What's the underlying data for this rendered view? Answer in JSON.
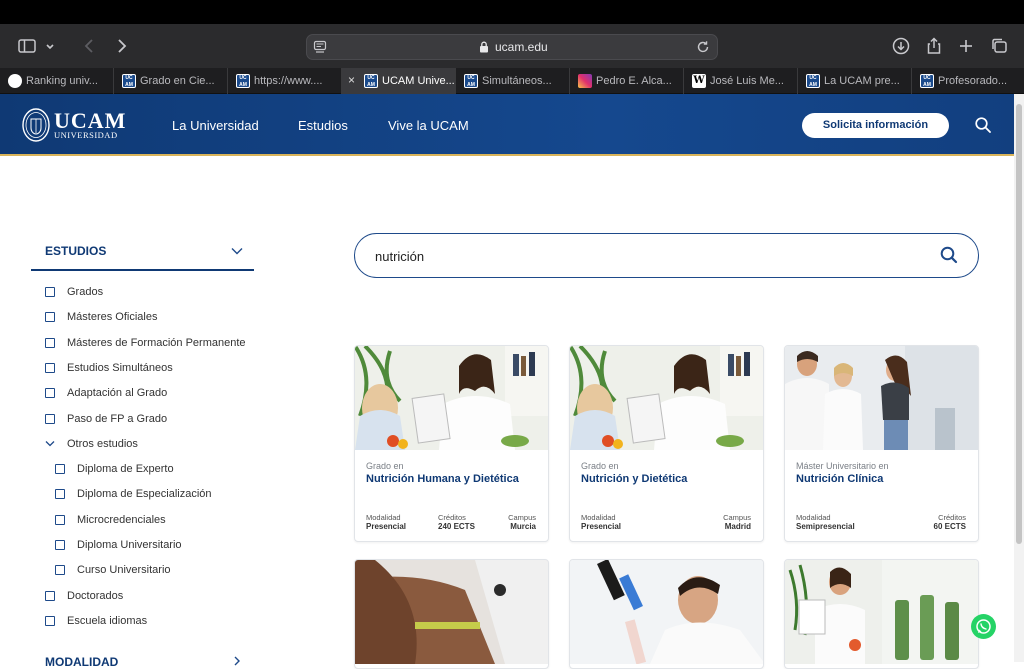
{
  "browser": {
    "url": "ucam.edu",
    "tabs": [
      {
        "label": "Ranking univ...",
        "icon": "ranking-favicon"
      },
      {
        "label": "Grado en Cie...",
        "icon": "ucam-favicon"
      },
      {
        "label": "https://www....",
        "icon": "ucam-favicon"
      },
      {
        "label": "UCAM Unive...",
        "icon": "ucam-favicon",
        "active": true
      },
      {
        "label": "Simultáneos...",
        "icon": "ucam-favicon"
      },
      {
        "label": "Pedro E. Alca...",
        "icon": "instagram-favicon"
      },
      {
        "label": "José Luis Me...",
        "icon": "wikipedia-favicon"
      },
      {
        "label": "La UCAM pre...",
        "icon": "ucam-favicon"
      },
      {
        "label": "Profesorado...",
        "icon": "ucam-favicon"
      }
    ]
  },
  "header": {
    "logo_name": "UCAM",
    "logo_sub": "UNIVERSIDAD",
    "nav": [
      "La Universidad",
      "Estudios",
      "Vive la UCAM"
    ],
    "cta": "Solicita información",
    "brand_color": "#0f3974",
    "accent_color": "#d9b45a"
  },
  "sidebar": {
    "title": "ESTUDIOS",
    "items": [
      {
        "label": "Grados"
      },
      {
        "label": "Másteres Oficiales"
      },
      {
        "label": "Másteres de Formación Permanente"
      },
      {
        "label": "Estudios Simultáneos"
      },
      {
        "label": "Adaptación al Grado"
      },
      {
        "label": "Paso de FP a Grado"
      },
      {
        "label": "Otros estudios",
        "expanded": true
      },
      {
        "label": "Diploma de Experto",
        "sub": true
      },
      {
        "label": "Diploma de Especialización",
        "sub": true
      },
      {
        "label": "Microcredenciales",
        "sub": true
      },
      {
        "label": "Diploma Universitario",
        "sub": true
      },
      {
        "label": "Curso Universitario",
        "sub": true
      },
      {
        "label": "Doctorados"
      },
      {
        "label": "Escuela idiomas"
      }
    ],
    "next_section": "MODALIDAD"
  },
  "search": {
    "value": "nutrición"
  },
  "cards": [
    {
      "kind": "Grado en",
      "title": "Nutrición Humana y Dietética",
      "meta": [
        {
          "label": "Modalidad",
          "value": "Presencial"
        },
        {
          "label": "Créditos",
          "value": "240 ECTS"
        },
        {
          "label": "Campus",
          "value": "Murcia"
        }
      ]
    },
    {
      "kind": "Grado en",
      "title": "Nutrición y Dietética",
      "meta": [
        {
          "label": "Modalidad",
          "value": "Presencial"
        },
        {
          "label": "Campus",
          "value": "Madrid"
        }
      ]
    },
    {
      "kind": "Máster Universitario en",
      "title": "Nutrición Clínica",
      "meta": [
        {
          "label": "Modalidad",
          "value": "Semipresencial"
        },
        {
          "label": "Créditos",
          "value": "60 ECTS"
        }
      ]
    }
  ]
}
